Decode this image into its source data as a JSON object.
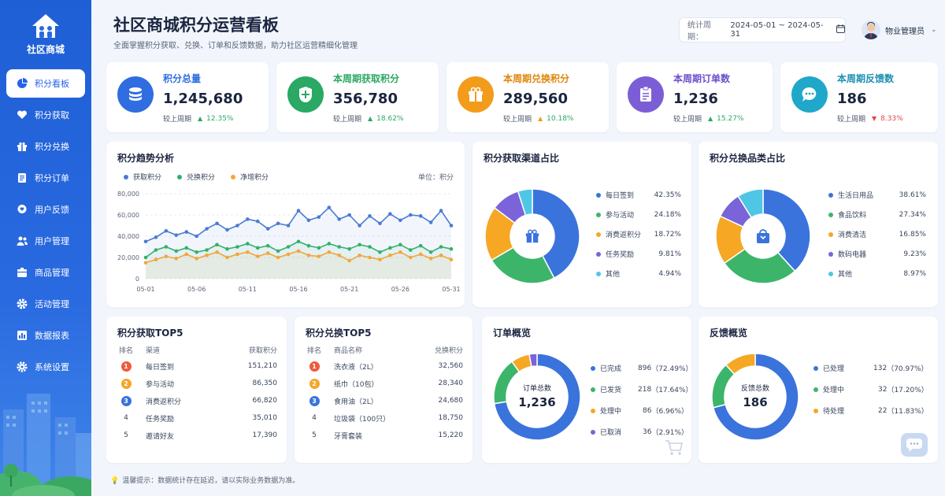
{
  "app": {
    "name": "社区商城",
    "title": "社区商城积分运营看板",
    "subtitle": "全面掌握积分获取、兑换、订单和反馈数据，助力社区运营精细化管理"
  },
  "header": {
    "period_label": "统计周期：",
    "period_value": "2024-05-01 ~ 2024-05-31",
    "user_name": "物业管理员"
  },
  "sidebar": {
    "items": [
      {
        "label": "积分看板",
        "icon": "pie-icon",
        "active": true
      },
      {
        "label": "积分获取",
        "icon": "heart-hand-icon"
      },
      {
        "label": "积分兑换",
        "icon": "gift-icon"
      },
      {
        "label": "积分订单",
        "icon": "document-icon"
      },
      {
        "label": "用户反馈",
        "icon": "feedback-icon"
      },
      {
        "label": "用户管理",
        "icon": "users-icon"
      },
      {
        "label": "商品管理",
        "icon": "box-icon"
      },
      {
        "label": "活动管理",
        "icon": "settings-icon"
      },
      {
        "label": "数据报表",
        "icon": "bar-chart-icon"
      },
      {
        "label": "系统设置",
        "icon": "gear-icon"
      }
    ]
  },
  "kpis": [
    {
      "label": "积分总量",
      "value": "1,245,680",
      "cmp_label": "较上周期",
      "direction": "up",
      "change": "12.35%",
      "color": "#2f6de0",
      "icon": "coins-icon"
    },
    {
      "label": "本周期获取积分",
      "value": "356,780",
      "cmp_label": "较上周期",
      "direction": "up",
      "change": "18.62%",
      "color": "#2aa864",
      "icon": "plus-shield-icon"
    },
    {
      "label": "本周期兑换积分",
      "value": "289,560",
      "cmp_label": "较上周期",
      "direction": "up",
      "change": "10.18%",
      "color": "#f39b1a",
      "icon": "gift-icon"
    },
    {
      "label": "本周期订单数",
      "value": "1,236",
      "cmp_label": "较上周期",
      "direction": "up",
      "change": "15.27%",
      "color": "#7b5ed6",
      "icon": "clipboard-icon"
    },
    {
      "label": "本周期反馈数",
      "value": "186",
      "cmp_label": "较上周期",
      "direction": "down",
      "change": "8.33%",
      "color": "#1fa8c9",
      "icon": "chat-icon"
    }
  ],
  "trend": {
    "title": "积分趋势分析",
    "unit": "单位：积分"
  },
  "sources": {
    "title": "积分获取渠道占比"
  },
  "categories": {
    "title": "积分兑换品类占比"
  },
  "top_earn": {
    "title": "积分获取TOP5",
    "headers": [
      "排名",
      "渠道",
      "获取积分"
    ],
    "rows": [
      {
        "rank": "1",
        "name": "每日签到",
        "value": "151,210"
      },
      {
        "rank": "2",
        "name": "参与活动",
        "value": "86,350"
      },
      {
        "rank": "3",
        "name": "消费返积分",
        "value": "66,820"
      },
      {
        "rank": "4",
        "name": "任务奖励",
        "value": "35,010"
      },
      {
        "rank": "5",
        "name": "邀请好友",
        "value": "17,390"
      }
    ]
  },
  "top_redeem": {
    "title": "积分兑换TOP5",
    "headers": [
      "排名",
      "商品名称",
      "兑换积分"
    ],
    "rows": [
      {
        "rank": "1",
        "name": "洗衣液（2L）",
        "value": "32,560"
      },
      {
        "rank": "2",
        "name": "纸巾（10包）",
        "value": "28,340"
      },
      {
        "rank": "3",
        "name": "食用油（2L）",
        "value": "24,680"
      },
      {
        "rank": "4",
        "name": "垃圾袋（100只）",
        "value": "18,750"
      },
      {
        "rank": "5",
        "name": "牙膏套装",
        "value": "15,220"
      }
    ]
  },
  "orders": {
    "title": "订单概览",
    "center_label": "订单总数",
    "center_value": "1,236"
  },
  "feedback": {
    "title": "反馈概览",
    "center_label": "反馈总数",
    "center_value": "186"
  },
  "tip": "温馨提示：数据统计存在延迟，请以实际业务数据为准。",
  "chart_data": [
    {
      "type": "line",
      "title": "积分趋势分析",
      "x": [
        "05-01",
        "05-02",
        "05-03",
        "05-04",
        "05-05",
        "05-06",
        "05-07",
        "05-08",
        "05-09",
        "05-10",
        "05-11",
        "05-12",
        "05-13",
        "05-14",
        "05-15",
        "05-16",
        "05-17",
        "05-18",
        "05-19",
        "05-20",
        "05-21",
        "05-22",
        "05-23",
        "05-24",
        "05-25",
        "05-26",
        "05-27",
        "05-28",
        "05-29",
        "05-30",
        "05-31"
      ],
      "xticks": [
        "05-01",
        "05-06",
        "05-11",
        "05-16",
        "05-21",
        "05-26",
        "05-31"
      ],
      "yticks": [
        "0",
        "20,000",
        "40,000",
        "60,000",
        "80,000"
      ],
      "ylim": [
        0,
        80000
      ],
      "grid": true,
      "legend": "top-left",
      "series": [
        {
          "name": "获取积分",
          "color": "#4a7bd4",
          "values": [
            35000,
            39000,
            45000,
            41000,
            44000,
            40000,
            47000,
            52000,
            46000,
            50000,
            56000,
            54000,
            47000,
            52000,
            50000,
            64000,
            55000,
            58000,
            67000,
            56000,
            60000,
            50000,
            59000,
            52000,
            61000,
            55000,
            60000,
            59000,
            53000,
            64000,
            50000
          ]
        },
        {
          "name": "兑换积分",
          "color": "#34b06c",
          "values": [
            20000,
            27000,
            30000,
            26000,
            29000,
            25000,
            27000,
            32000,
            28000,
            30000,
            33000,
            29000,
            31000,
            26000,
            30000,
            35000,
            31000,
            29000,
            33000,
            30000,
            28000,
            32000,
            30000,
            25000,
            29000,
            32000,
            27000,
            31000,
            25000,
            30000,
            28000
          ]
        },
        {
          "name": "净增积分",
          "color": "#f2a73b",
          "values": [
            15000,
            18000,
            21000,
            19000,
            23000,
            19000,
            22000,
            25000,
            20000,
            23000,
            25000,
            21000,
            24000,
            20000,
            23000,
            26000,
            22000,
            21000,
            25000,
            22000,
            17000,
            22000,
            20000,
            18000,
            22000,
            25000,
            20000,
            23000,
            19000,
            22000,
            18000
          ]
        }
      ]
    },
    {
      "type": "pie",
      "title": "积分获取渠道占比",
      "labels": [
        "每日签到",
        "参与活动",
        "消费返积分",
        "任务奖励",
        "其他"
      ],
      "values": [
        42.35,
        24.18,
        18.72,
        9.81,
        4.94
      ],
      "display": [
        "42.35%",
        "24.18%",
        "18.72%",
        "9.81%",
        "4.94%"
      ],
      "colors": [
        "#3b73dc",
        "#3cb56a",
        "#f6a724",
        "#7b63d9",
        "#4fc6e6"
      ]
    },
    {
      "type": "pie",
      "title": "积分兑换品类占比",
      "labels": [
        "生活日用品",
        "食品饮料",
        "消费清洁",
        "数码电器",
        "其他"
      ],
      "values": [
        38.61,
        27.34,
        16.85,
        9.23,
        8.97
      ],
      "display": [
        "38.61%",
        "27.34%",
        "16.85%",
        "9.23%",
        "8.97%"
      ],
      "colors": [
        "#3b73dc",
        "#3cb56a",
        "#f6a724",
        "#7b63d9",
        "#4fc6e6"
      ]
    },
    {
      "type": "pie",
      "title": "订单概览",
      "labels": [
        "已完成",
        "已发货",
        "处理中",
        "已取消"
      ],
      "counts": [
        "896",
        "218",
        "86",
        "36"
      ],
      "values": [
        72.49,
        17.64,
        6.96,
        2.91
      ],
      "display": [
        "（72.49%）",
        "（17.64%）",
        "（6.96%）",
        "（2.91%）"
      ],
      "colors": [
        "#3b73dc",
        "#3cb56a",
        "#f6a724",
        "#7b63d9"
      ]
    },
    {
      "type": "pie",
      "title": "反馈概览",
      "labels": [
        "已处理",
        "处理中",
        "待处理"
      ],
      "counts": [
        "132",
        "32",
        "22"
      ],
      "values": [
        70.97,
        17.2,
        11.83
      ],
      "display": [
        "（70.97%）",
        "（17.20%）",
        "（11.83%）"
      ],
      "colors": [
        "#3b73dc",
        "#3cb56a",
        "#f6a724"
      ]
    }
  ]
}
